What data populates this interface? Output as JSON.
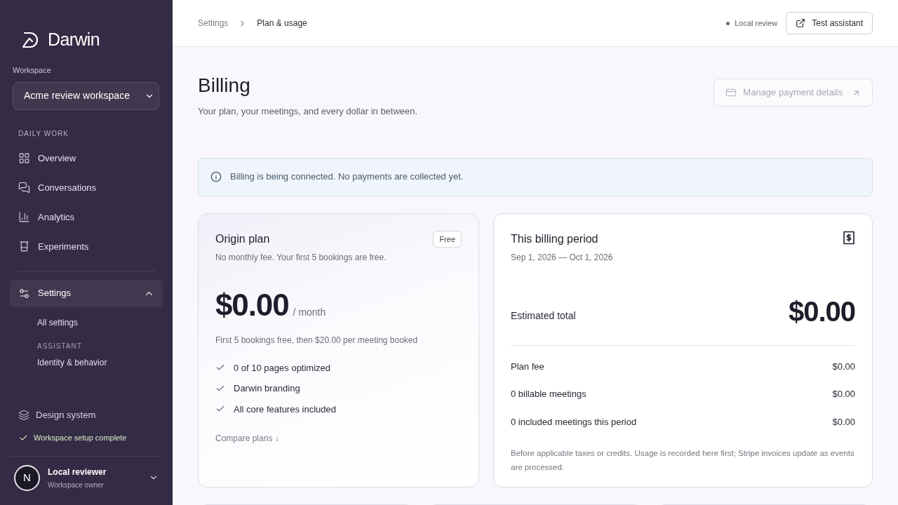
{
  "sidebar": {
    "brand": "Darwin",
    "workspace": {
      "label": "Workspace",
      "value": "Acme review workspace"
    },
    "section": {
      "heading": "DAILY WORK",
      "items": [
        {
          "label": "Overview",
          "selected": false
        },
        {
          "label": "Conversations",
          "selected": false
        },
        {
          "label": "Analytics",
          "selected": false
        },
        {
          "label": "Experiments",
          "selected": false
        }
      ]
    },
    "settings": {
      "label": "Settings",
      "selected": true,
      "expanded": true,
      "children": [
        {
          "kind": "link",
          "label": "All settings"
        },
        {
          "kind": "heading",
          "label": "ASSISTANT"
        },
        {
          "kind": "link",
          "label": "Identity & behavior"
        }
      ]
    },
    "design_system": {
      "label": "Design system"
    },
    "setup_status": {
      "label": "Workspace setup complete"
    },
    "user": {
      "initial": "N",
      "name": "Local reviewer",
      "role": "Workspace owner"
    }
  },
  "header": {
    "breadcrumb": [
      {
        "label": "Settings",
        "current": false
      },
      {
        "label": "Plan & usage",
        "current": true
      }
    ],
    "status": "Local review",
    "action": "Test assistant"
  },
  "page": {
    "title": "Billing",
    "subtitle": "Your plan, your meetings, and every dollar in between.",
    "manage_button": {
      "label": "Manage payment details",
      "disabled": true
    },
    "notice": "Billing is being connected. No payments are collected yet."
  },
  "plan_card": {
    "title": "Origin plan",
    "badge": "Free",
    "description": "No monthly fee. Your first 5 bookings are free.",
    "price": "$0.00",
    "period": "/ month",
    "note": "First 5 bookings free, then $20.00 per meeting booked",
    "features": [
      "0 of 10 pages optimized",
      "Darwin branding",
      "All core features included"
    ],
    "link": "Compare plans ↓"
  },
  "billing_card": {
    "title": "This billing period",
    "dates": "Sep 1, 2026 — Oct 1, 2026",
    "total_label": "Estimated total",
    "total": "$0.00",
    "lines": [
      {
        "label": "Plan fee",
        "amount": "$0.00"
      },
      {
        "label": "0 billable meetings",
        "amount": "$0.00"
      },
      {
        "label": "0 included meetings this period",
        "amount": "$0.00"
      }
    ],
    "footnote": "Before applicable taxes or credits. Usage is recorded here first; Stripe invoices update as events are processed."
  }
}
